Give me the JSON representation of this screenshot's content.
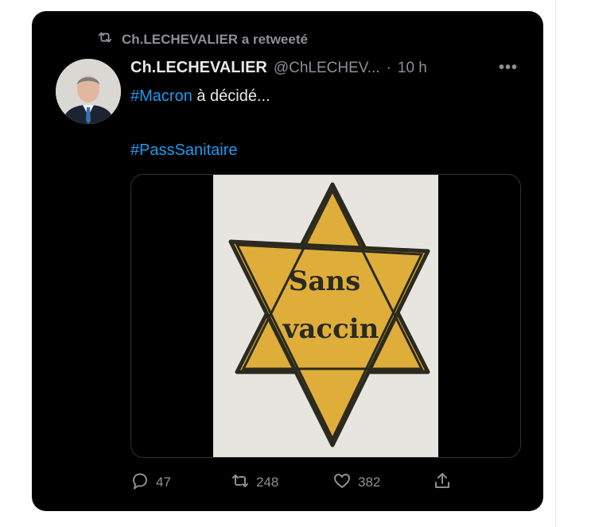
{
  "retweet_banner": {
    "text": "Ch.LECHEVALIER a retweeté",
    "icon": "retweet-icon"
  },
  "author": {
    "name": "Ch.LECHEVALIER",
    "handle": "@ChLECHEV...",
    "separator": "·",
    "time": "10 h",
    "avatar_icon": "avatar"
  },
  "more_menu": "•••",
  "tweet": {
    "line1_hashtag": "#Macron",
    "line1_text": " à décidé...",
    "line2_hashtag": "#PassSanitaire"
  },
  "media": {
    "star_text_line1": "Sans",
    "star_text_line2": "vaccin"
  },
  "actions": {
    "reply_count": "47",
    "retweet_count": "248",
    "like_count": "382"
  },
  "colors": {
    "background": "#000000",
    "text": "#e7e9ea",
    "muted": "#8b9096",
    "hashtag": "#1d9bf0",
    "star": "#e0b23c"
  }
}
